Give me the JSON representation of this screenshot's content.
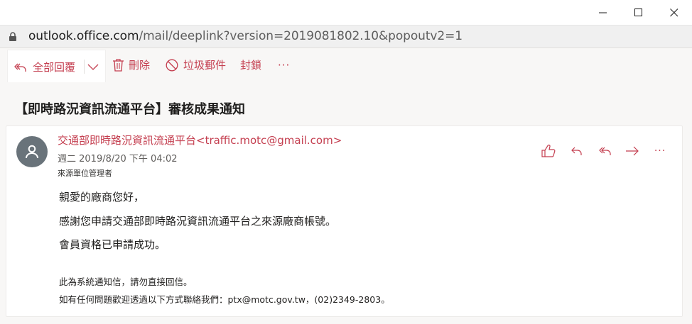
{
  "window": {
    "minimize_icon": "minimize-icon",
    "maximize_icon": "maximize-icon",
    "close_icon": "close-icon"
  },
  "address": {
    "lock_icon": "lock-icon",
    "host": "outlook.office.com",
    "path": "/mail/deeplink?version=2019081802.10&popoutv2=1"
  },
  "toolbar": {
    "reply_all": "全部回覆",
    "delete": "刪除",
    "junk": "垃圾郵件",
    "block": "封鎖",
    "more": "···"
  },
  "message": {
    "subject": "【即時路況資訊流通平台】審核成果通知",
    "sender": "交通部即時路況資訊流通平台<traffic.motc@gmail.com>",
    "date": "週二 2019/8/20 下午 04:02",
    "to": "來源單位管理者",
    "more": "···",
    "body": [
      "親愛的廠商您好，",
      "感謝您申請交通部即時路況資訊流通平台之來源廠商帳號。",
      "會員資格已申請成功。"
    ],
    "notes": [
      "此為系統通知信，請勿直接回信。",
      "如有任何問題歡迎透過以下方式聯絡我們：ptx@motc.gov.tw，(02)2349-2803。"
    ]
  },
  "colors": {
    "accent": "#c43e4f",
    "avatar": "#69737a",
    "band": "#f8f7f6"
  }
}
